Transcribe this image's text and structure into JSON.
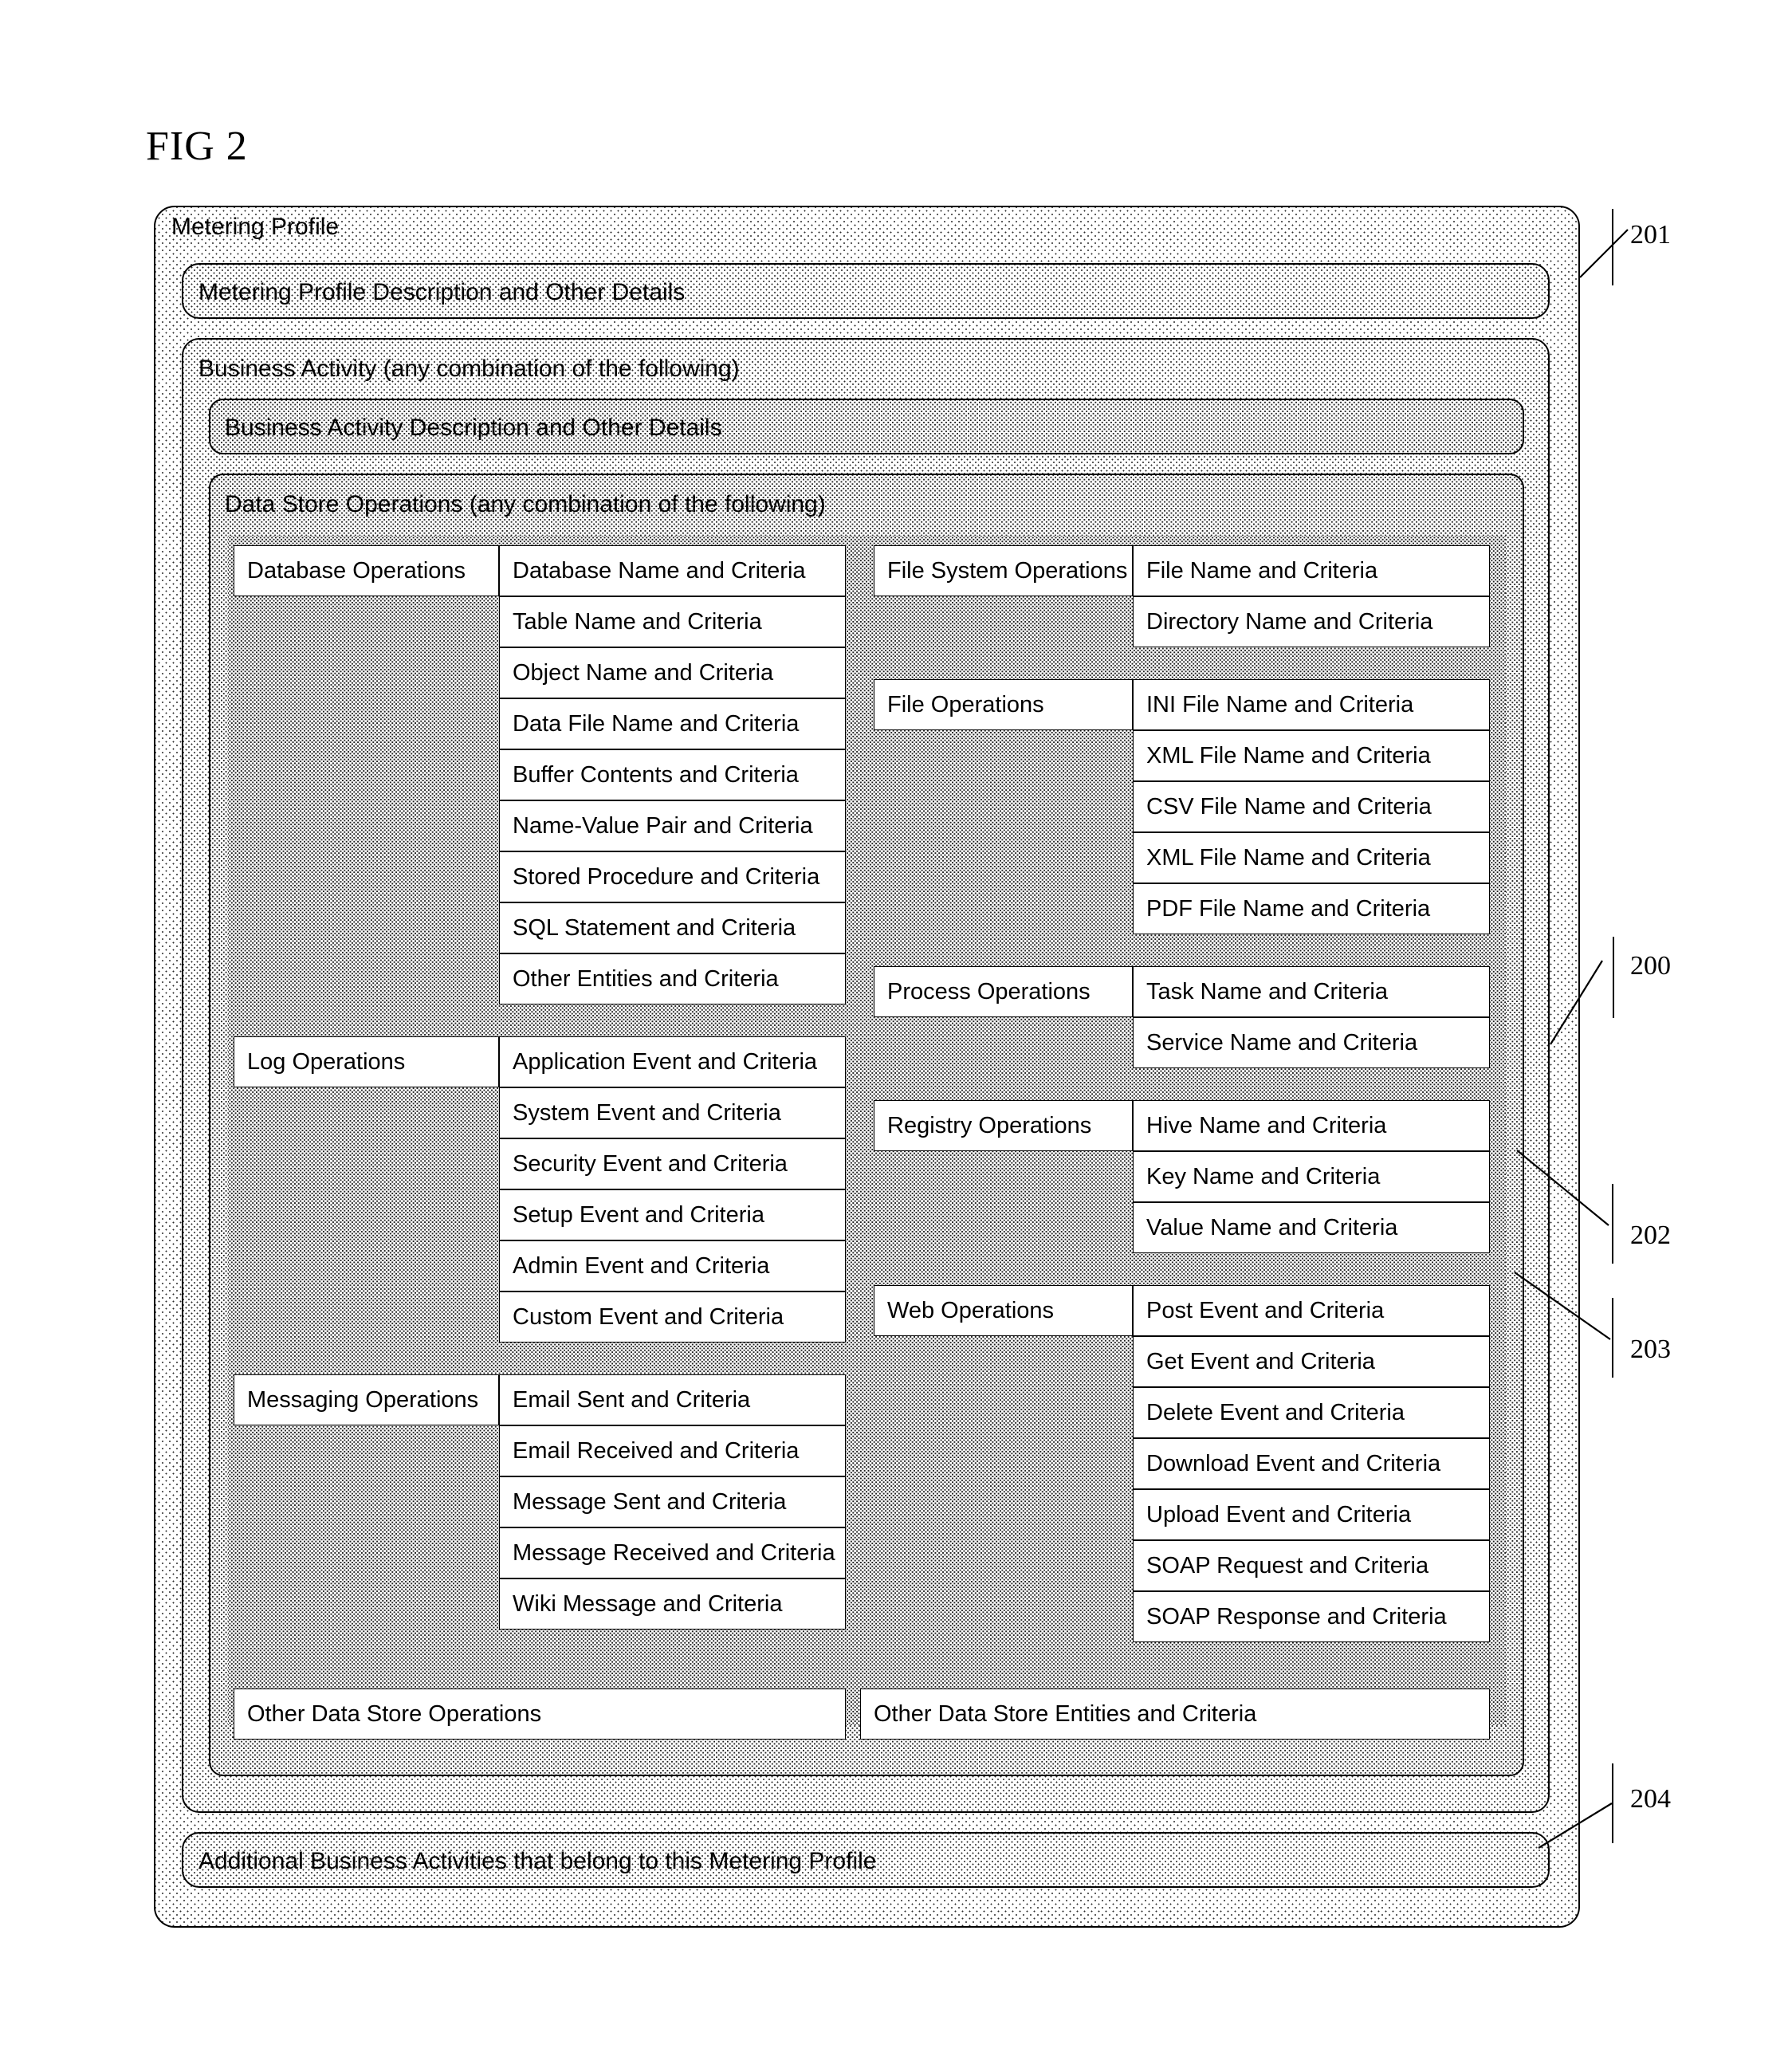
{
  "figure": {
    "title": "FIG 2"
  },
  "metering_profile": {
    "label": "Metering Profile",
    "description_box": "Metering Profile Description and Other Details"
  },
  "business_activity": {
    "label": "Business Activity (any combination of the following)",
    "description_box": "Business Activity Description and Other Details"
  },
  "data_store_operations": {
    "label": "Data Store Operations  (any combination of the following)",
    "left_groups": [
      {
        "head": "Database Operations",
        "items": [
          "Database Name and Criteria",
          "Table Name and Criteria",
          "Object Name and Criteria",
          "Data File Name and Criteria",
          "Buffer Contents and Criteria",
          "Name-Value Pair and Criteria",
          "Stored Procedure and Criteria",
          "SQL Statement and Criteria",
          "Other Entities and Criteria"
        ]
      },
      {
        "head": "Log Operations",
        "items": [
          "Application Event and Criteria",
          "System Event and Criteria",
          "Security Event and Criteria",
          "Setup Event and Criteria",
          "Admin Event and Criteria",
          "Custom Event and Criteria"
        ]
      },
      {
        "head": "Messaging Operations",
        "items": [
          "Email Sent and Criteria",
          "Email Received and Criteria",
          "Message Sent and Criteria",
          "Message Received and Criteria",
          "Wiki Message and Criteria"
        ]
      }
    ],
    "right_groups": [
      {
        "head": "File System Operations",
        "items": [
          "File Name and Criteria",
          "Directory Name and Criteria"
        ]
      },
      {
        "head": "File Operations",
        "items": [
          "INI File Name and Criteria",
          "XML File Name and Criteria",
          "CSV File Name and Criteria",
          "XML File Name and Criteria",
          "PDF  File Name and Criteria"
        ]
      },
      {
        "head": "Process Operations",
        "items": [
          "Task Name and Criteria",
          "Service Name and Criteria"
        ]
      },
      {
        "head": "Registry Operations",
        "items": [
          "Hive Name and Criteria",
          "Key Name and Criteria",
          "Value Name and Criteria"
        ]
      },
      {
        "head": "Web Operations",
        "items": [
          "Post Event and Criteria",
          "Get Event and Criteria",
          "Delete Event and Criteria",
          "Download Event and Criteria",
          "Upload Event and Criteria",
          "SOAP Request and Criteria",
          "SOAP Response and Criteria"
        ]
      }
    ],
    "other_left": "Other Data Store Operations",
    "other_right": "Other Data Store Entities and Criteria"
  },
  "additional_activities": {
    "label": "Additional Business Activities that belong to this Metering Profile"
  },
  "callouts": [
    {
      "number": "201"
    },
    {
      "number": "200"
    },
    {
      "number": "202"
    },
    {
      "number": "203"
    },
    {
      "number": "204"
    }
  ]
}
